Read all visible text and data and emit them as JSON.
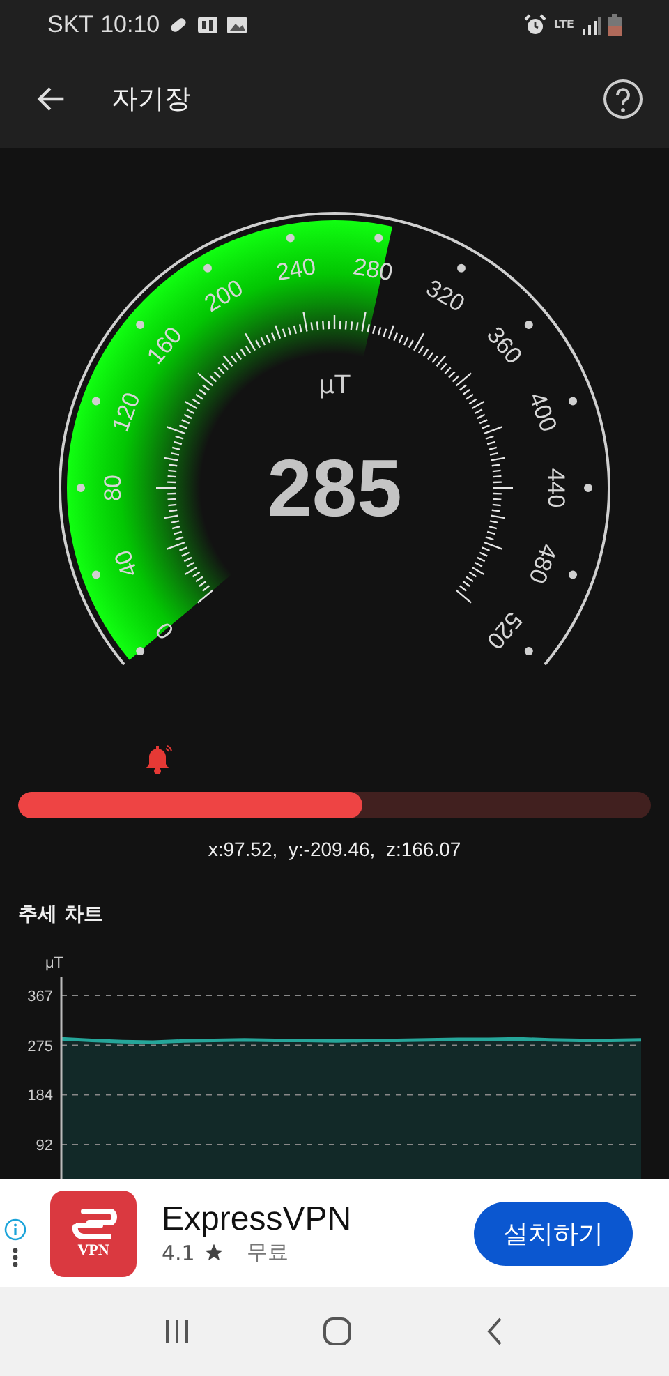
{
  "status_bar": {
    "carrier": "SKT",
    "time": "10:10",
    "network": "LTE"
  },
  "app_bar": {
    "title": "자기장"
  },
  "gauge": {
    "unit": "μT",
    "value": "285",
    "labels": [
      "0",
      "40",
      "80",
      "120",
      "160",
      "200",
      "240",
      "280",
      "320",
      "360",
      "400",
      "440",
      "480",
      "520"
    ]
  },
  "alarm_bar": {
    "level": 0.544
  },
  "axes_reading": "x:97.52,  y:-209.46,  z:166.07",
  "trend": {
    "title": "추세 차트",
    "chart_data": {
      "type": "area",
      "ylabel": "μT",
      "grid": true,
      "ylim": [
        0,
        367
      ],
      "yticks": [
        92,
        184,
        275,
        367
      ],
      "color": "#26a69a",
      "values": [
        287,
        284,
        282,
        281,
        283,
        284,
        285,
        284,
        284,
        283,
        284,
        284,
        285,
        286,
        286,
        287,
        285,
        284,
        284,
        285
      ]
    }
  },
  "ad": {
    "logo_text": "VPN",
    "title": "ExpressVPN",
    "rating": "4.1",
    "price": "무료",
    "button": "설치하기"
  }
}
